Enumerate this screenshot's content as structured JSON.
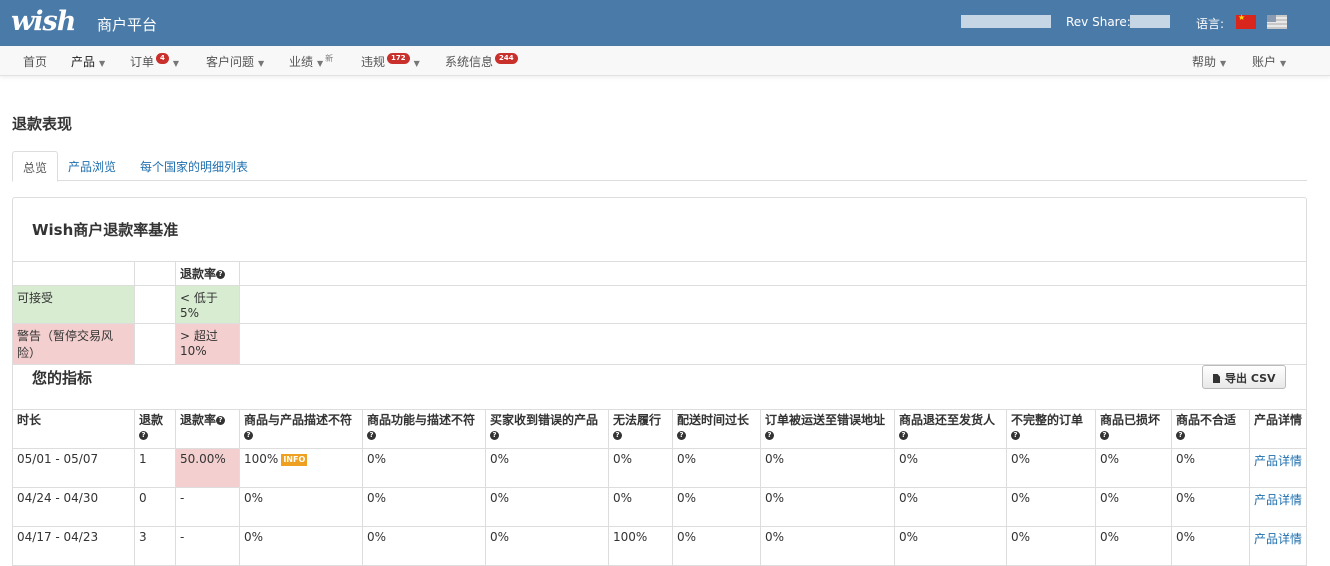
{
  "header": {
    "logo": "wish",
    "platform": "商户平台",
    "rev_share_label": "Rev Share: ",
    "lang_label": "语言:",
    "flags": [
      "china-flag-icon",
      "us-flag-icon"
    ]
  },
  "nav": {
    "items": [
      {
        "label": "首页"
      },
      {
        "label": "产品"
      },
      {
        "label": "订单",
        "badge": "4"
      },
      {
        "label": "客户问题"
      },
      {
        "label": "业绩",
        "sup": "新"
      },
      {
        "label": "违规",
        "badge": "172"
      },
      {
        "label": "系统信息",
        "badge": "244"
      }
    ],
    "right": [
      {
        "label": "帮助"
      },
      {
        "label": "账户"
      }
    ]
  },
  "page": {
    "title": "退款表现",
    "tabs": [
      "总览",
      "产品浏览",
      "每个国家的明细列表"
    ]
  },
  "benchmark": {
    "title": "Wish商户退款率基准",
    "header": "退款率",
    "rows": [
      {
        "label": "可接受",
        "value": "< 低于5%"
      },
      {
        "label": "警告（暂停交易风险）",
        "value": "> 超过10%"
      }
    ]
  },
  "metrics": {
    "title": "您的指标",
    "export_label": "导出 CSV",
    "columns": [
      "时长",
      "退款",
      "退款率",
      "商品与产品描述不符",
      "商品功能与描述不符",
      "买家收到错误的产品",
      "无法履行",
      "配送时间过长",
      "订单被运送至错误地址",
      "商品退还至发货人",
      "不完整的订单",
      "商品已损坏",
      "商品不合适",
      "产品详情"
    ],
    "info_badge": "INFO",
    "rows": [
      {
        "period": "05/01 - 05/07",
        "refunds": "1",
        "rate": "50.00%",
        "c1": "100%",
        "c2": "0%",
        "c3": "0%",
        "c4": "0%",
        "c5": "0%",
        "c6": "0%",
        "c7": "0%",
        "c8": "0%",
        "c9": "0%",
        "c10": "0%",
        "link": "产品详情"
      },
      {
        "period": "04/24 - 04/30",
        "refunds": "0",
        "rate": "-",
        "c1": "0%",
        "c2": "0%",
        "c3": "0%",
        "c4": "0%",
        "c5": "0%",
        "c6": "0%",
        "c7": "0%",
        "c8": "0%",
        "c9": "0%",
        "c10": "0%",
        "link": "产品详情"
      },
      {
        "period": "04/17 - 04/23",
        "refunds": "3",
        "rate": "-",
        "c1": "0%",
        "c2": "0%",
        "c3": "0%",
        "c4": "100%",
        "c5": "0%",
        "c6": "0%",
        "c7": "0%",
        "c8": "0%",
        "c9": "0%",
        "c10": "0%",
        "link": "产品详情"
      }
    ]
  }
}
